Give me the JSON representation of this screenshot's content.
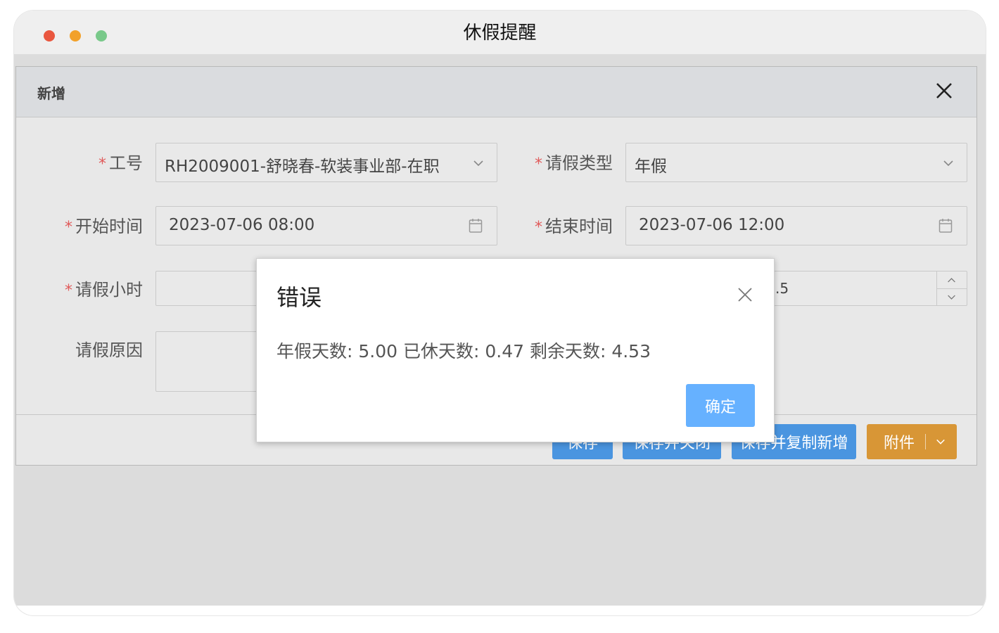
{
  "window": {
    "title": "休假提醒"
  },
  "form": {
    "title": "新增",
    "fields": {
      "employee_id": {
        "label": "工号",
        "value": "RH2009001-舒晓春-软装事业部-在职"
      },
      "leave_type": {
        "label": "请假类型",
        "value": "年假"
      },
      "start_time": {
        "label": "开始时间",
        "value": "2023-07-06 08:00"
      },
      "end_time": {
        "label": "结束时间",
        "value": "2023-07-06 12:00"
      },
      "leave_hours": {
        "label": "请假小时",
        "value": ""
      },
      "leave_days_partial": {
        "value": ".5"
      },
      "reason": {
        "label": "请假原因",
        "value": ""
      }
    },
    "required_mark": "*",
    "buttons": {
      "save": "保存",
      "save_close": "保存并关闭",
      "save_copy_new": "保存并复制新增",
      "attachment": "附件"
    }
  },
  "error_modal": {
    "title": "错误",
    "message": "年假天数: 5.00 已休天数: 0.47 剩余天数: 4.53",
    "ok_label": "确定"
  }
}
